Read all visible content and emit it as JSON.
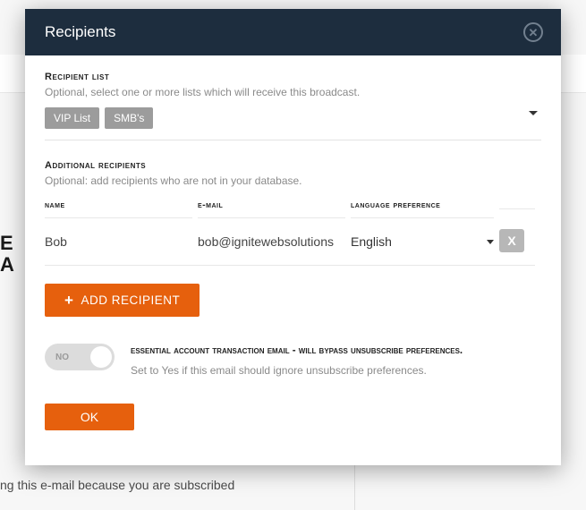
{
  "background": {
    "left_text_line1": "E R",
    "left_text_line2": "A C",
    "bottom_text": "ng this e-mail because you are subscribed"
  },
  "modal": {
    "title": "Recipients",
    "recipient_list": {
      "label": "recipient list",
      "hint": "Optional, select one or more lists which will receive this broadcast.",
      "chips": [
        "VIP List",
        "SMB's"
      ]
    },
    "additional": {
      "label": "additional recipients",
      "hint": "Optional: add recipients who are not in your database.",
      "columns": {
        "name": "name",
        "email": "e-mail",
        "language": "language preference"
      },
      "rows": [
        {
          "name": "Bob",
          "email": "bob@ignitewebsolutions",
          "language": "English",
          "remove": "X"
        }
      ],
      "add_button": "ADD RECIPIENT"
    },
    "essential": {
      "toggle_value": "NO",
      "title": "essential account transaction email - will bypass unsubscribe preferences.",
      "hint": "Set to Yes if this email should ignore unsubscribe preferences."
    },
    "ok_button": "OK"
  }
}
